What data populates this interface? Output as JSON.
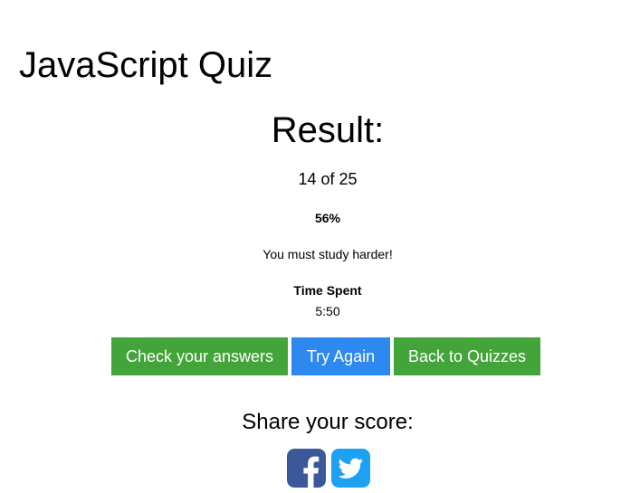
{
  "page": {
    "title": "JavaScript Quiz"
  },
  "result": {
    "heading": "Result:",
    "score": "14 of 25",
    "percent": "56%",
    "message": "You must study harder!",
    "time_label": "Time Spent",
    "time_value": "5:50"
  },
  "actions": {
    "check_answers_label": "Check your answers",
    "try_again_label": "Try Again",
    "back_label": "Back to Quizzes"
  },
  "share": {
    "heading": "Share your score:",
    "icons": [
      "facebook-icon",
      "twitter-icon"
    ]
  },
  "colors": {
    "green_button": "#43a43a",
    "blue_button": "#2d89f0",
    "facebook": "#3b5998",
    "twitter": "#1da1f2"
  }
}
